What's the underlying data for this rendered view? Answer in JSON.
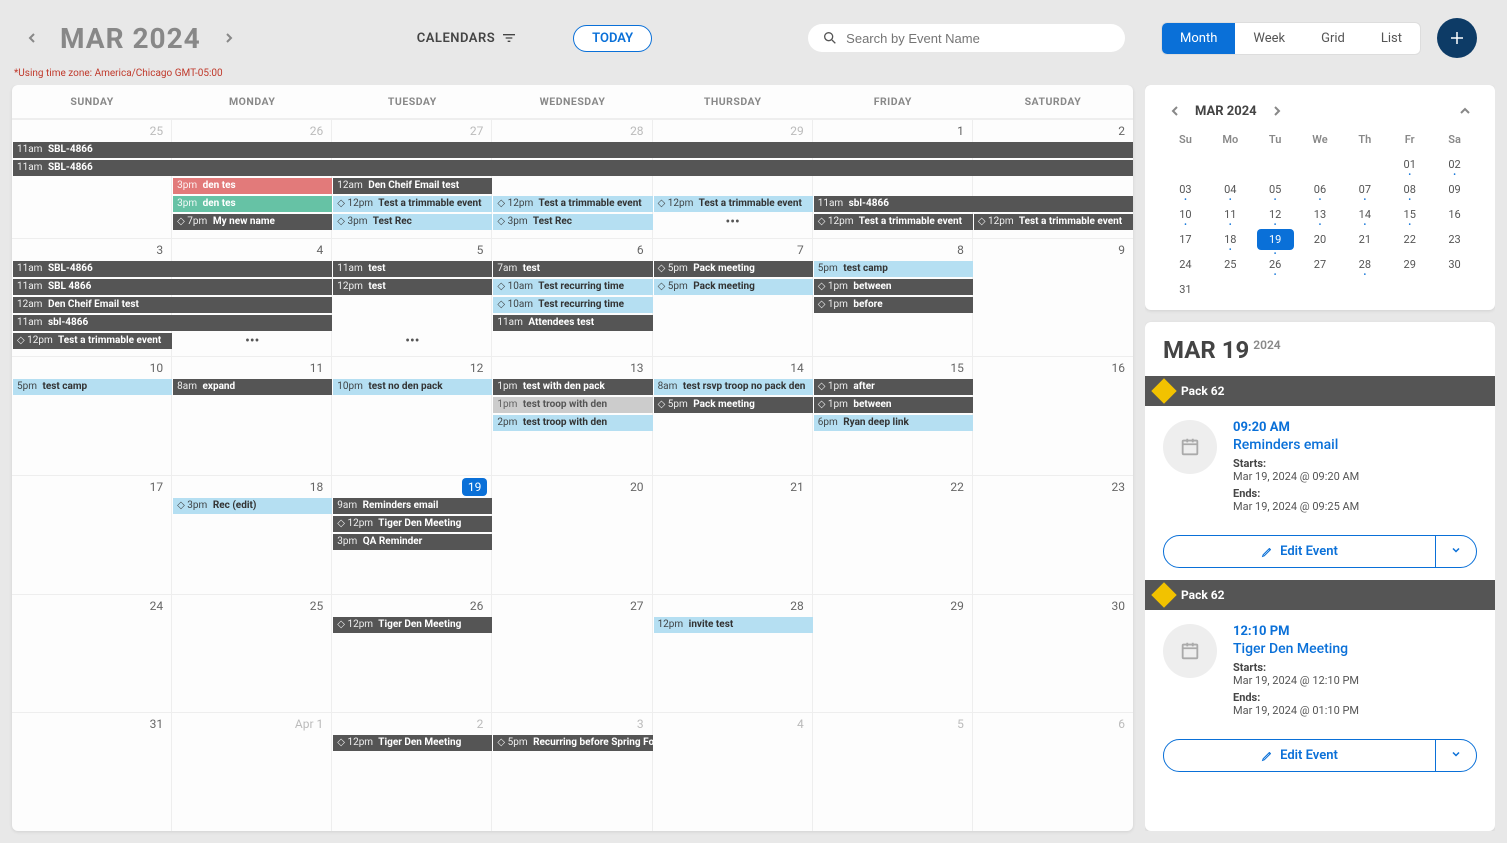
{
  "header": {
    "month_title": "MAR 2024",
    "calendars_label": "CALENDARS",
    "today_label": "TODAY",
    "search_placeholder": "Search by Event Name",
    "views": {
      "month": "Month",
      "week": "Week",
      "grid": "Grid",
      "list": "List"
    }
  },
  "tz_note": "*Using time zone: America/Chicago GMT-05:00",
  "dow": [
    "SUNDAY",
    "MONDAY",
    "TUESDAY",
    "WEDNESDAY",
    "THURSDAY",
    "FRIDAY",
    "SATURDAY"
  ],
  "weeks": [
    {
      "days": [
        {
          "n": "25",
          "other": true
        },
        {
          "n": "26",
          "other": true
        },
        {
          "n": "27",
          "other": true
        },
        {
          "n": "28",
          "other": true
        },
        {
          "n": "29",
          "other": true
        },
        {
          "n": "1"
        },
        {
          "n": "2"
        }
      ],
      "rows": [
        [
          {
            "start": 1,
            "span": 7,
            "cls": "dark",
            "time": "11am",
            "title": "SBL-4866"
          }
        ],
        [
          {
            "start": 1,
            "span": 7,
            "cls": "dark",
            "time": "11am",
            "title": "SBL-4866"
          }
        ],
        [
          {
            "start": 2,
            "span": 1,
            "cls": "red",
            "time": "3pm",
            "title": "den tes"
          },
          {
            "start": 3,
            "span": 1,
            "cls": "dark",
            "time": "12am",
            "title": "Den Cheif Email test"
          }
        ],
        [
          {
            "start": 2,
            "span": 1,
            "cls": "teal",
            "time": "3pm",
            "title": "den tes"
          },
          {
            "start": 3,
            "span": 1,
            "cls": "blue",
            "time": "◇ 12pm",
            "title": "Test a trimmable event"
          },
          {
            "start": 4,
            "span": 1,
            "cls": "blue",
            "time": "◇ 12pm",
            "title": "Test a trimmable event"
          },
          {
            "start": 5,
            "span": 1,
            "cls": "blue",
            "time": "◇ 12pm",
            "title": "Test a trimmable event"
          },
          {
            "start": 6,
            "span": 2,
            "cls": "dark",
            "time": "11am",
            "title": "sbl-4866"
          }
        ],
        [
          {
            "start": 2,
            "span": 1,
            "cls": "dark",
            "time": "◇ 7pm",
            "title": "My new name"
          },
          {
            "start": 3,
            "span": 1,
            "cls": "blue",
            "time": "◇ 3pm",
            "title": "Test Rec"
          },
          {
            "start": 4,
            "span": 1,
            "cls": "blue",
            "time": "◇ 3pm",
            "title": "Test Rec"
          },
          {
            "start": 5,
            "span": 1,
            "cls": "more",
            "title": "•••"
          },
          {
            "start": 6,
            "span": 1,
            "cls": "dark",
            "time": "◇ 12pm",
            "title": "Test a trimmable event"
          },
          {
            "start": 7,
            "span": 1,
            "cls": "dark",
            "time": "◇ 12pm",
            "title": "Test a trimmable event"
          }
        ]
      ]
    },
    {
      "days": [
        {
          "n": "3"
        },
        {
          "n": "4"
        },
        {
          "n": "5"
        },
        {
          "n": "6"
        },
        {
          "n": "7"
        },
        {
          "n": "8"
        },
        {
          "n": "9"
        }
      ],
      "rows": [
        [
          {
            "start": 1,
            "span": 2,
            "cls": "dark",
            "time": "11am",
            "title": "SBL-4866"
          },
          {
            "start": 3,
            "span": 1,
            "cls": "dark",
            "time": "11am",
            "title": "test"
          },
          {
            "start": 4,
            "span": 1,
            "cls": "dark",
            "time": "7am",
            "title": "test"
          },
          {
            "start": 5,
            "span": 1,
            "cls": "dark",
            "time": "◇ 5pm",
            "title": "Pack meeting"
          },
          {
            "start": 6,
            "span": 1,
            "cls": "blue",
            "time": "5pm",
            "title": "test camp"
          }
        ],
        [
          {
            "start": 1,
            "span": 2,
            "cls": "dark",
            "time": "11am",
            "title": "SBL 4866"
          },
          {
            "start": 3,
            "span": 1,
            "cls": "dark",
            "time": "12pm",
            "title": "test"
          },
          {
            "start": 4,
            "span": 1,
            "cls": "blue",
            "time": "◇ 10am",
            "title": "Test recurring time"
          },
          {
            "start": 5,
            "span": 1,
            "cls": "blue",
            "time": "◇ 5pm",
            "title": "Pack meeting"
          },
          {
            "start": 6,
            "span": 1,
            "cls": "dark",
            "time": "◇ 1pm",
            "title": "between"
          }
        ],
        [
          {
            "start": 1,
            "span": 2,
            "cls": "dark",
            "time": "12am",
            "title": "Den Cheif Email test"
          },
          {
            "start": 4,
            "span": 1,
            "cls": "blue",
            "time": "◇ 10am",
            "title": "Test recurring time"
          },
          {
            "start": 6,
            "span": 1,
            "cls": "dark",
            "time": "◇ 1pm",
            "title": "before"
          }
        ],
        [
          {
            "start": 1,
            "span": 2,
            "cls": "dark",
            "time": "11am",
            "title": "sbl-4866"
          },
          {
            "start": 4,
            "span": 1,
            "cls": "dark",
            "time": "11am",
            "title": "Attendees test"
          }
        ],
        [
          {
            "start": 1,
            "span": 1,
            "cls": "dark",
            "time": "◇ 12pm",
            "title": "Test a trimmable event"
          },
          {
            "start": 2,
            "span": 1,
            "cls": "more",
            "title": "•••"
          },
          {
            "start": 3,
            "span": 1,
            "cls": "more",
            "title": "•••"
          }
        ]
      ]
    },
    {
      "days": [
        {
          "n": "10"
        },
        {
          "n": "11"
        },
        {
          "n": "12"
        },
        {
          "n": "13"
        },
        {
          "n": "14"
        },
        {
          "n": "15"
        },
        {
          "n": "16"
        }
      ],
      "rows": [
        [
          {
            "start": 1,
            "span": 1,
            "cls": "blue",
            "time": "5pm",
            "title": "test camp"
          },
          {
            "start": 2,
            "span": 1,
            "cls": "dark",
            "time": "8am",
            "title": "expand"
          },
          {
            "start": 3,
            "span": 1,
            "cls": "blue",
            "time": "10pm",
            "title": "test no den pack"
          },
          {
            "start": 4,
            "span": 1,
            "cls": "dark",
            "time": "1pm",
            "title": "test with den pack"
          },
          {
            "start": 5,
            "span": 1,
            "cls": "blue",
            "time": "8am",
            "title": "test rsvp troop no pack den"
          },
          {
            "start": 6,
            "span": 1,
            "cls": "dark",
            "time": "◇ 1pm",
            "title": "after"
          }
        ],
        [
          {
            "start": 4,
            "span": 1,
            "cls": "grey",
            "time": "1pm",
            "title": "test troop with den"
          },
          {
            "start": 5,
            "span": 1,
            "cls": "dark",
            "time": "◇ 5pm",
            "title": "Pack meeting"
          },
          {
            "start": 6,
            "span": 1,
            "cls": "dark",
            "time": "◇ 1pm",
            "title": "between"
          }
        ],
        [
          {
            "start": 4,
            "span": 1,
            "cls": "blue",
            "time": "2pm",
            "title": "test troop with den"
          },
          {
            "start": 6,
            "span": 1,
            "cls": "blue",
            "time": "6pm",
            "title": "Ryan deep link"
          }
        ]
      ]
    },
    {
      "days": [
        {
          "n": "17"
        },
        {
          "n": "18"
        },
        {
          "n": "19",
          "today": true
        },
        {
          "n": "20"
        },
        {
          "n": "21"
        },
        {
          "n": "22"
        },
        {
          "n": "23"
        }
      ],
      "rows": [
        [
          {
            "start": 2,
            "span": 1,
            "cls": "blue",
            "time": "◇ 3pm",
            "title": "Rec (edit)"
          },
          {
            "start": 3,
            "span": 1,
            "cls": "dark",
            "time": "9am",
            "title": "Reminders email"
          }
        ],
        [
          {
            "start": 3,
            "span": 1,
            "cls": "dark",
            "time": "◇ 12pm",
            "title": "Tiger Den Meeting"
          }
        ],
        [
          {
            "start": 3,
            "span": 1,
            "cls": "dark",
            "time": "3pm",
            "title": "QA Reminder"
          }
        ]
      ]
    },
    {
      "days": [
        {
          "n": "24"
        },
        {
          "n": "25"
        },
        {
          "n": "26"
        },
        {
          "n": "27"
        },
        {
          "n": "28"
        },
        {
          "n": "29"
        },
        {
          "n": "30"
        }
      ],
      "rows": [
        [
          {
            "start": 3,
            "span": 1,
            "cls": "dark",
            "time": "◇ 12pm",
            "title": "Tiger Den Meeting"
          },
          {
            "start": 5,
            "span": 1,
            "cls": "blue",
            "time": "12pm",
            "title": "invite test"
          }
        ]
      ]
    },
    {
      "days": [
        {
          "n": "31"
        },
        {
          "n": "Apr 1",
          "other": true
        },
        {
          "n": "2",
          "other": true
        },
        {
          "n": "3",
          "other": true
        },
        {
          "n": "4",
          "other": true
        },
        {
          "n": "5",
          "other": true
        },
        {
          "n": "6",
          "other": true
        }
      ],
      "rows": [
        [
          {
            "start": 3,
            "span": 1,
            "cls": "dark",
            "time": "◇ 12pm",
            "title": "Tiger Den Meeting"
          },
          {
            "start": 4,
            "span": 1,
            "cls": "dark",
            "time": "◇ 5pm",
            "title": "Recurring before Spring Forward af"
          }
        ]
      ]
    }
  ],
  "mini": {
    "title": "MAR 2024",
    "dow": [
      "Su",
      "Mo",
      "Tu",
      "We",
      "Th",
      "Fr",
      "Sa"
    ],
    "weeks": [
      [
        "",
        "",
        "",
        "",
        "",
        "01",
        "02"
      ],
      [
        "03",
        "04",
        "05",
        "06",
        "07",
        "08",
        "09"
      ],
      [
        "10",
        "11",
        "12",
        "13",
        "14",
        "15",
        "16"
      ],
      [
        "17",
        "18",
        "19",
        "20",
        "21",
        "22",
        "23"
      ],
      [
        "24",
        "25",
        "26",
        "27",
        "28",
        "29",
        "30"
      ],
      [
        "31",
        "",
        "",
        "",
        "",
        "",
        ""
      ]
    ],
    "dots": [
      "01",
      "02",
      "03",
      "04",
      "05",
      "06",
      "07",
      "08",
      "10",
      "11",
      "12",
      "13",
      "14",
      "15",
      "18",
      "19",
      "26",
      "28"
    ],
    "today": "19"
  },
  "detail": {
    "date_label": "MAR 19",
    "year": "2024",
    "events": [
      {
        "pack": "Pack 62",
        "time": "09:20 AM",
        "name": "Reminders email",
        "starts_lbl": "Starts:",
        "starts": "Mar 19, 2024 @ 09:20 AM",
        "ends_lbl": "Ends:",
        "ends": "Mar 19, 2024 @ 09:25 AM",
        "edit": "Edit Event"
      },
      {
        "pack": "Pack 62",
        "time": "12:10 PM",
        "name": "Tiger Den Meeting",
        "starts_lbl": "Starts:",
        "starts": "Mar 19, 2024 @ 12:10 PM",
        "ends_lbl": "Ends:",
        "ends": "Mar 19, 2024 @ 01:10 PM",
        "edit": "Edit Event"
      }
    ]
  }
}
